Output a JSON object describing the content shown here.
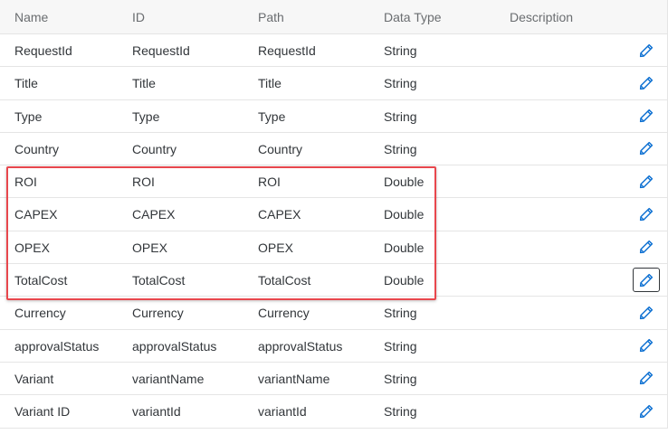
{
  "columns": {
    "name": "Name",
    "id": "ID",
    "path": "Path",
    "data_type": "Data Type",
    "description": "Description"
  },
  "rows": [
    {
      "name": "RequestId",
      "id": "RequestId",
      "path": "RequestId",
      "data_type": "String",
      "description": ""
    },
    {
      "name": "Title",
      "id": "Title",
      "path": "Title",
      "data_type": "String",
      "description": ""
    },
    {
      "name": "Type",
      "id": "Type",
      "path": "Type",
      "data_type": "String",
      "description": ""
    },
    {
      "name": "Country",
      "id": "Country",
      "path": "Country",
      "data_type": "String",
      "description": ""
    },
    {
      "name": "ROI",
      "id": "ROI",
      "path": "ROI",
      "data_type": "Double",
      "description": ""
    },
    {
      "name": "CAPEX",
      "id": "CAPEX",
      "path": "CAPEX",
      "data_type": "Double",
      "description": ""
    },
    {
      "name": "OPEX",
      "id": "OPEX",
      "path": "OPEX",
      "data_type": "Double",
      "description": ""
    },
    {
      "name": "TotalCost",
      "id": "TotalCost",
      "path": "TotalCost",
      "data_type": "Double",
      "description": ""
    },
    {
      "name": "Currency",
      "id": "Currency",
      "path": "Currency",
      "data_type": "String",
      "description": ""
    },
    {
      "name": "approvalStatus",
      "id": "approvalStatus",
      "path": "approvalStatus",
      "data_type": "String",
      "description": ""
    },
    {
      "name": "Variant",
      "id": "variantName",
      "path": "variantName",
      "data_type": "String",
      "description": ""
    },
    {
      "name": "Variant ID",
      "id": "variantId",
      "path": "variantId",
      "data_type": "String",
      "description": ""
    }
  ],
  "row_action_icon": "pencil-icon",
  "colors": {
    "icon": "#0a6ed1",
    "highlight": "#e8474d",
    "header_bg": "#f7f7f7",
    "header_text": "#6a6d70",
    "text": "#32363a",
    "border": "#e5e5e5"
  }
}
